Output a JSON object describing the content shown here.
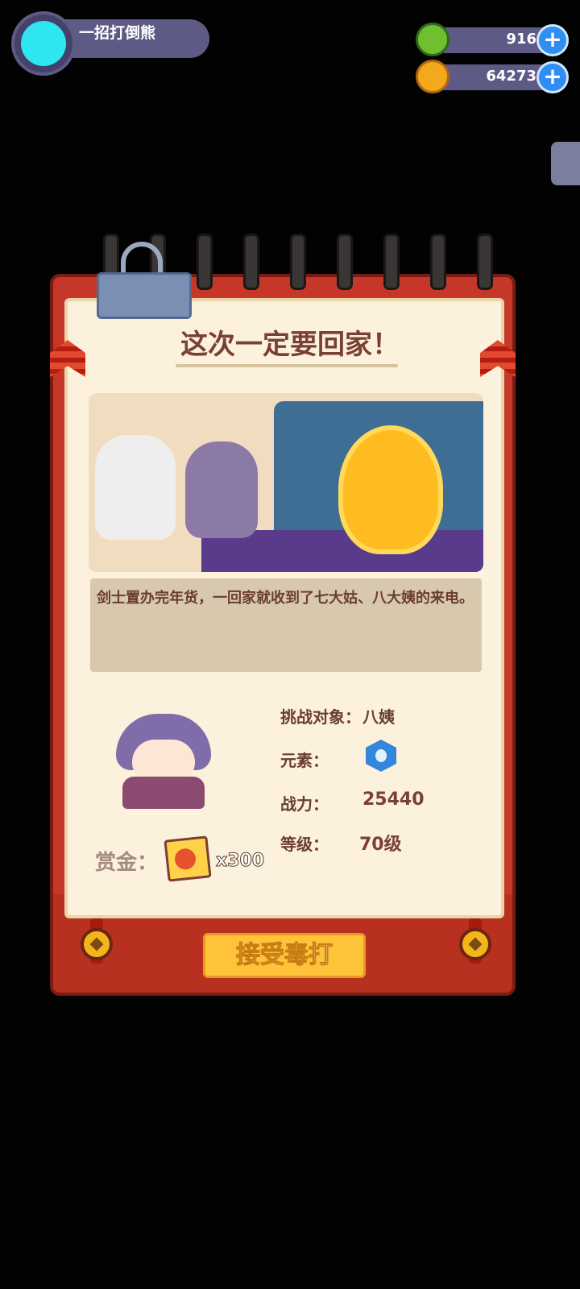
{
  "player": {
    "name": "一招打倒熊"
  },
  "currencies": [
    {
      "value": "916",
      "icon": "green-gem-icon",
      "color": "#6fbf2e"
    },
    {
      "value": "64273",
      "icon": "gold-planet-coin-icon",
      "color": "#f4a81c"
    }
  ],
  "quest": {
    "title": "这次一定要回家！",
    "description": "剑士置办完年货，一回家就收到了七大姑、八大姨的来电。",
    "target_label": "挑战对象：",
    "target_value": "八姨",
    "element_label": "元素：",
    "element_icon": "water-hexagon-icon",
    "power_label": "战力：",
    "power_value": "25440",
    "level_label": "等级：",
    "level_value": "70级",
    "reward_label": "赏金：",
    "reward_icon": "ticket-icon",
    "reward_qty": "x300",
    "accept_label": "接受毒打"
  },
  "colors": {
    "frame_red": "#c6372a",
    "paper": "#fbf1dc",
    "accent_gold": "#ffc33b",
    "text_brown": "#6b3d32"
  }
}
